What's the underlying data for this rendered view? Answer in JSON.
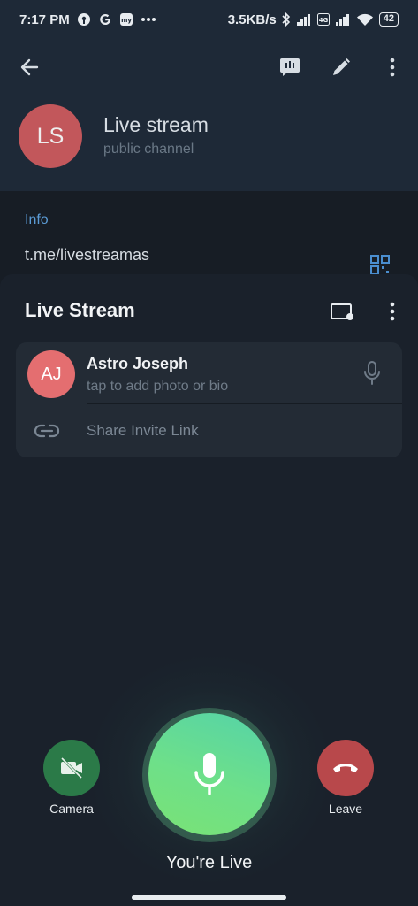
{
  "status_bar": {
    "time": "7:17 PM",
    "speed": "3.5KB/s",
    "battery": "42",
    "left_icons": [
      "podcast-icon",
      "google-icon",
      "app-icon",
      "more-dots-icon"
    ],
    "right_icons": [
      "bluetooth-icon",
      "signal-icon",
      "volte-icon",
      "signal-icon",
      "wifi-icon"
    ]
  },
  "header": {
    "avatar_initials": "LS",
    "title": "Live stream",
    "subtitle": "public channel",
    "avatar_color": "#c2575b"
  },
  "info": {
    "title": "Info",
    "link": "t.me/livestreamas"
  },
  "sheet": {
    "title": "Live Stream",
    "participants": [
      {
        "initials": "AJ",
        "name": "Astro Joseph",
        "subtitle": "tap to add photo or bio",
        "avatar_color": "#e46e70"
      }
    ],
    "invite_label": "Share Invite Link"
  },
  "controls": {
    "camera_label": "Camera",
    "leave_label": "Leave",
    "status_label": "You're Live",
    "camera_color": "#2b7a48",
    "leave_color": "#b8484b",
    "mic_color": "#6ee089"
  }
}
